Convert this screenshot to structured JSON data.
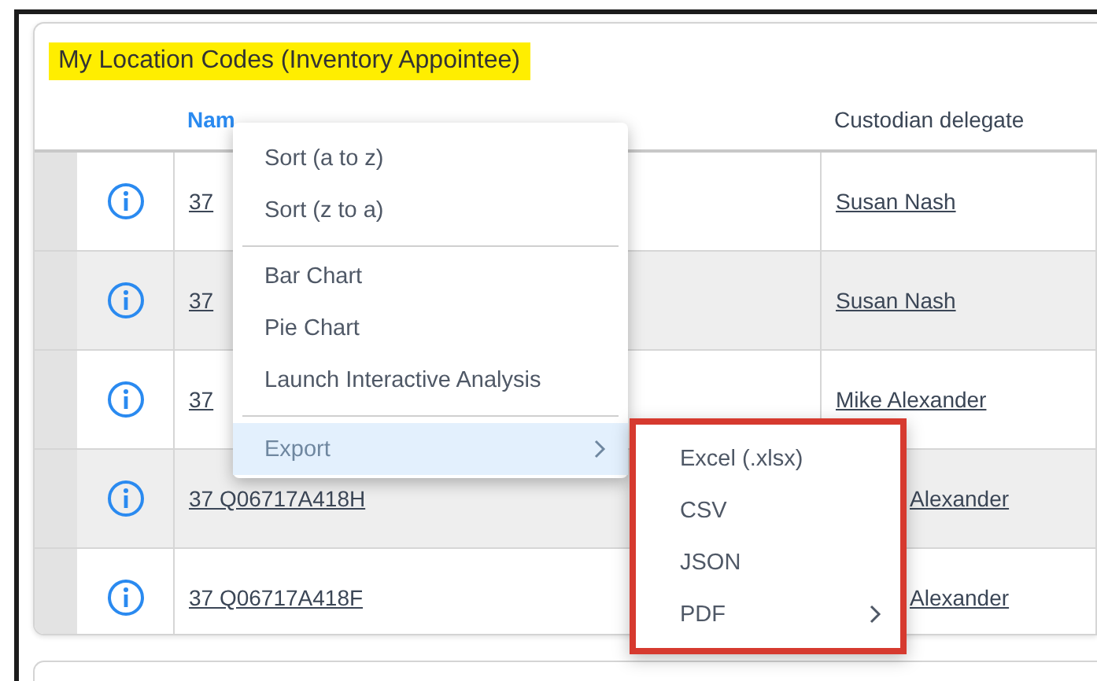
{
  "card": {
    "title": "My Location Codes (Inventory Appointee)"
  },
  "table": {
    "columns": [
      {
        "label": "Nam",
        "sorted": true
      },
      {
        "label": "Custodian delegate",
        "sorted": false
      }
    ],
    "rows": [
      {
        "name": "37",
        "custodian": "Susan Nash"
      },
      {
        "name": "37",
        "custodian": "Susan Nash"
      },
      {
        "name": "37",
        "custodian": "Mike Alexander"
      },
      {
        "name": "37 Q06717A418H",
        "custodian": "Alexander",
        "partly_covered": true
      },
      {
        "name": "37 Q06717A418F",
        "custodian": "Alexander",
        "partly_covered": true
      }
    ]
  },
  "context_menu": {
    "groups": [
      [
        {
          "label": "Sort (a to z)",
          "kind": "item",
          "selected": false
        },
        {
          "label": "Sort (z to a)",
          "kind": "item",
          "selected": false
        }
      ],
      [
        {
          "label": "Bar Chart",
          "kind": "item",
          "selected": false
        },
        {
          "label": "Pie Chart",
          "kind": "item",
          "selected": false
        },
        {
          "label": "Launch Interactive Analysis",
          "kind": "item",
          "selected": false
        }
      ],
      [
        {
          "label": "Export",
          "kind": "submenu",
          "selected": true
        }
      ]
    ]
  },
  "submenu": {
    "items": [
      {
        "label": "Excel (.xlsx)",
        "kind": "item"
      },
      {
        "label": "CSV",
        "kind": "item"
      },
      {
        "label": "JSON",
        "kind": "item"
      },
      {
        "label": "PDF",
        "kind": "submenu"
      }
    ]
  }
}
